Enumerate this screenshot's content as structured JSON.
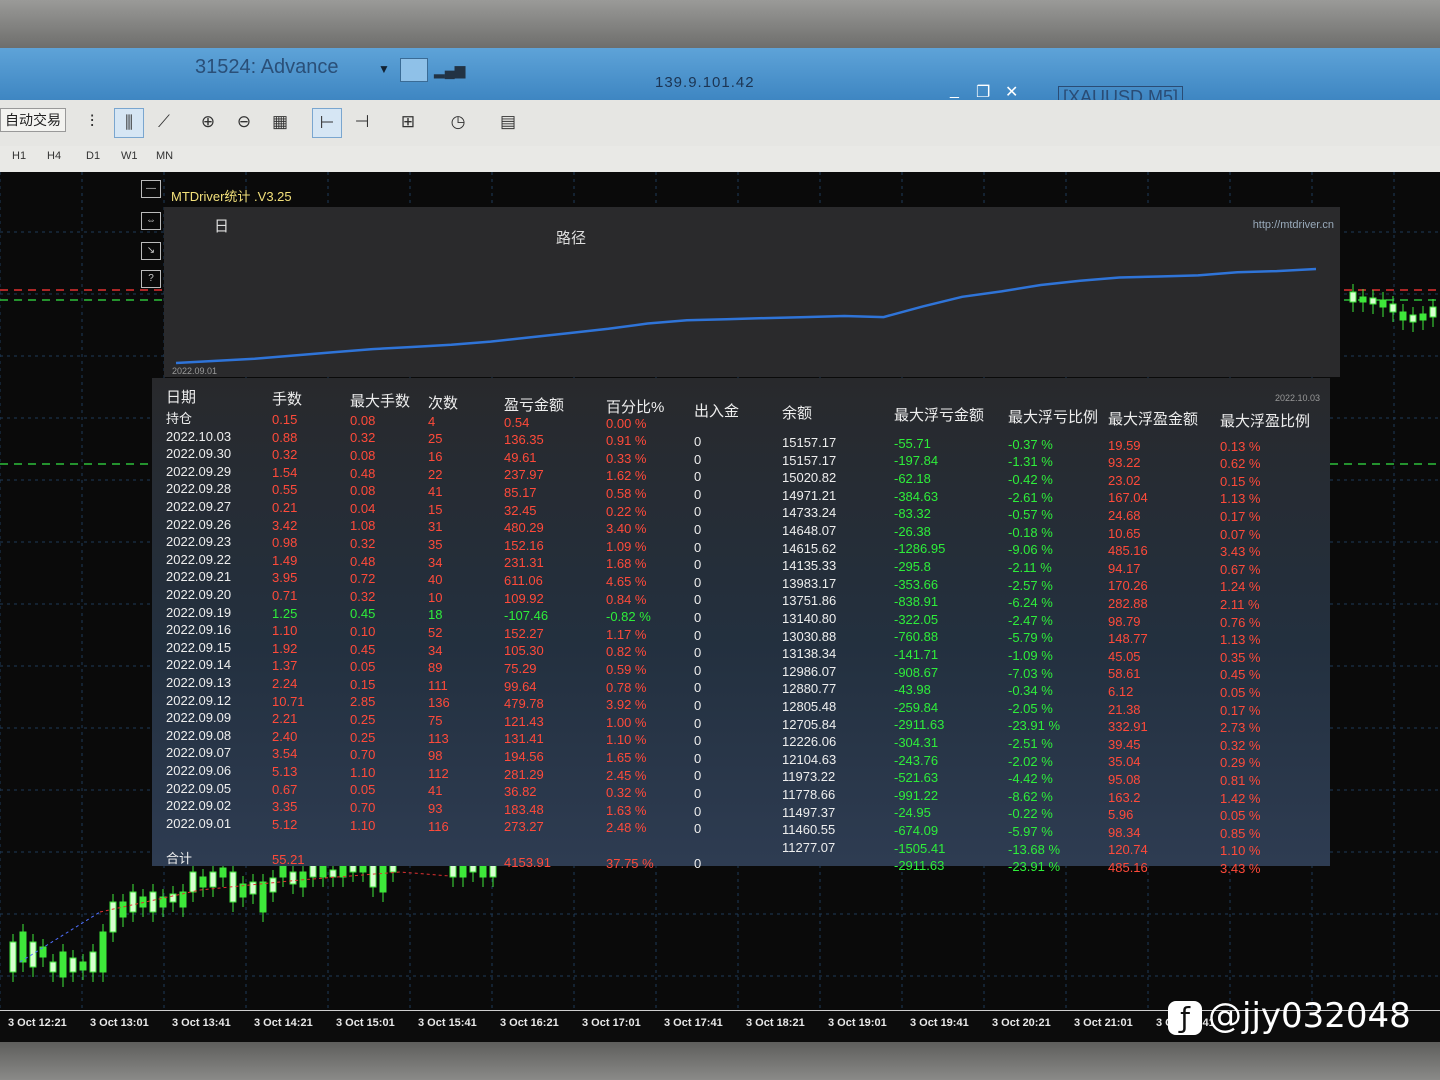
{
  "window": {
    "app_title": "31524: Advance",
    "ip": "139.9.101.42",
    "symbol": "[XAUUSD,M5]",
    "minimize": "_",
    "restore": "❐",
    "close": "✕"
  },
  "toolbar": {
    "auto_trading": "自动交易",
    "timeframes": [
      "H1",
      "H4",
      "D1",
      "W1",
      "MN"
    ]
  },
  "panel": {
    "title": "MTDriver统计 .V3.25",
    "period": "日",
    "chart_title": "路径",
    "url": "http://mtdriver.cn",
    "start_date": "2022.09.01",
    "end_date": "2022.10.03"
  },
  "table": {
    "headers": [
      "日期",
      "手数",
      "最大手数",
      "次数",
      "盈亏金额",
      "百分比%",
      "出入金",
      "余额",
      "最大浮亏金额",
      "最大浮亏比例",
      "最大浮盈金额",
      "最大浮盈比例"
    ],
    "holding_label": "持仓",
    "holding": [
      "0.15",
      "0.08",
      "4",
      "0.54",
      "0.00 %"
    ],
    "rows": [
      [
        "2022.10.03",
        "0.88",
        "0.32",
        "25",
        "136.35",
        "0.91 %",
        "0",
        "15157.17",
        "-55.71",
        "-0.37 %",
        "19.59",
        "0.13 %"
      ],
      [
        "2022.09.30",
        "0.32",
        "0.08",
        "16",
        "49.61",
        "0.33 %",
        "0",
        "15157.17",
        "-197.84",
        "-1.31 %",
        "93.22",
        "0.62 %"
      ],
      [
        "2022.09.29",
        "1.54",
        "0.48",
        "22",
        "237.97",
        "1.62 %",
        "0",
        "15020.82",
        "-62.18",
        "-0.42 %",
        "23.02",
        "0.15 %"
      ],
      [
        "2022.09.28",
        "0.55",
        "0.08",
        "41",
        "85.17",
        "0.58 %",
        "0",
        "14971.21",
        "-384.63",
        "-2.61 %",
        "167.04",
        "1.13 %"
      ],
      [
        "2022.09.27",
        "0.21",
        "0.04",
        "15",
        "32.45",
        "0.22 %",
        "0",
        "14733.24",
        "-83.32",
        "-0.57 %",
        "24.68",
        "0.17 %"
      ],
      [
        "2022.09.26",
        "3.42",
        "1.08",
        "31",
        "480.29",
        "3.40 %",
        "0",
        "14648.07",
        "-26.38",
        "-0.18 %",
        "10.65",
        "0.07 %"
      ],
      [
        "2022.09.23",
        "0.98",
        "0.32",
        "35",
        "152.16",
        "1.09 %",
        "0",
        "14615.62",
        "-1286.95",
        "-9.06 %",
        "485.16",
        "3.43 %"
      ],
      [
        "2022.09.22",
        "1.49",
        "0.48",
        "34",
        "231.31",
        "1.68 %",
        "0",
        "14135.33",
        "-295.8",
        "-2.11 %",
        "94.17",
        "0.67 %"
      ],
      [
        "2022.09.21",
        "3.95",
        "0.72",
        "40",
        "611.06",
        "4.65 %",
        "0",
        "13983.17",
        "-353.66",
        "-2.57 %",
        "170.26",
        "1.24 %"
      ],
      [
        "2022.09.20",
        "0.71",
        "0.32",
        "10",
        "109.92",
        "0.84 %",
        "0",
        "13751.86",
        "-838.91",
        "-6.24 %",
        "282.88",
        "2.11 %"
      ],
      [
        "2022.09.19",
        "1.25",
        "0.45",
        "18",
        "-107.46",
        "-0.82 %",
        "0",
        "13140.80",
        "-322.05",
        "-2.47 %",
        "98.79",
        "0.76 %"
      ],
      [
        "2022.09.16",
        "1.10",
        "0.10",
        "52",
        "152.27",
        "1.17 %",
        "0",
        "13030.88",
        "-760.88",
        "-5.79 %",
        "148.77",
        "1.13 %"
      ],
      [
        "2022.09.15",
        "1.92",
        "0.45",
        "34",
        "105.30",
        "0.82 %",
        "0",
        "13138.34",
        "-141.71",
        "-1.09 %",
        "45.05",
        "0.35 %"
      ],
      [
        "2022.09.14",
        "1.37",
        "0.05",
        "89",
        "75.29",
        "0.59 %",
        "0",
        "12986.07",
        "-908.67",
        "-7.03 %",
        "58.61",
        "0.45 %"
      ],
      [
        "2022.09.13",
        "2.24",
        "0.15",
        "111",
        "99.64",
        "0.78 %",
        "0",
        "12880.77",
        "-43.98",
        "-0.34 %",
        "6.12",
        "0.05 %"
      ],
      [
        "2022.09.12",
        "10.71",
        "2.85",
        "136",
        "479.78",
        "3.92 %",
        "0",
        "12805.48",
        "-259.84",
        "-2.05 %",
        "21.38",
        "0.17 %"
      ],
      [
        "2022.09.09",
        "2.21",
        "0.25",
        "75",
        "121.43",
        "1.00 %",
        "0",
        "12705.84",
        "-2911.63",
        "-23.91 %",
        "332.91",
        "2.73 %"
      ],
      [
        "2022.09.08",
        "2.40",
        "0.25",
        "113",
        "131.41",
        "1.10 %",
        "0",
        "12226.06",
        "-304.31",
        "-2.51 %",
        "39.45",
        "0.32 %"
      ],
      [
        "2022.09.07",
        "3.54",
        "0.70",
        "98",
        "194.56",
        "1.65 %",
        "0",
        "12104.63",
        "-243.76",
        "-2.02 %",
        "35.04",
        "0.29 %"
      ],
      [
        "2022.09.06",
        "5.13",
        "1.10",
        "112",
        "281.29",
        "2.45 %",
        "0",
        "11973.22",
        "-521.63",
        "-4.42 %",
        "95.08",
        "0.81 %"
      ],
      [
        "2022.09.05",
        "0.67",
        "0.05",
        "41",
        "36.82",
        "0.32 %",
        "0",
        "11778.66",
        "-991.22",
        "-8.62 %",
        "163.2",
        "1.42 %"
      ],
      [
        "2022.09.02",
        "3.35",
        "0.70",
        "93",
        "183.48",
        "1.63 %",
        "0",
        "11497.37",
        "-24.95",
        "-0.22 %",
        "5.96",
        "0.05 %"
      ],
      [
        "2022.09.01",
        "5.12",
        "1.10",
        "116",
        "273.27",
        "2.48 %",
        "0",
        "11460.55",
        "-674.09",
        "-5.97 %",
        "98.34",
        "0.85 %"
      ]
    ],
    "extra_balance": "11277.07",
    "extra_float": [
      "-1505.41",
      "-13.68 %",
      "120.74",
      "1.10 %"
    ],
    "total_label": "合计",
    "total": [
      "55.21",
      "4153.91",
      "37.75 %",
      "0",
      "-2911.63",
      "-23.91 %",
      "485.16",
      "3.43 %"
    ]
  },
  "path_chart": {
    "type": "line",
    "series": [
      {
        "values": [
          0,
          2,
          4,
          7,
          10,
          13,
          15,
          17,
          20,
          24,
          28,
          32,
          37,
          40,
          41,
          42,
          43,
          44,
          43,
          53,
          62,
          67,
          73,
          77,
          80,
          81,
          82,
          85,
          86,
          88
        ]
      }
    ],
    "color": "#2f74d8"
  },
  "time_axis": [
    "3 Oct 12:21",
    "3 Oct 13:01",
    "3 Oct 13:41",
    "3 Oct 14:21",
    "3 Oct 15:01",
    "3 Oct 15:41",
    "3 Oct 16:21",
    "3 Oct 17:01",
    "3 Oct 17:41",
    "3 Oct 18:21",
    "3 Oct 19:01",
    "3 Oct 19:41",
    "3 Oct 20:21",
    "3 Oct 21:01",
    "3 Oct 21:41"
  ],
  "watermark": "@jjy032048",
  "colors": {
    "profit": "#ff4a3a",
    "loss": "#2eee3a",
    "candle": "#3ee83a",
    "grid": "#2a4a6a"
  }
}
